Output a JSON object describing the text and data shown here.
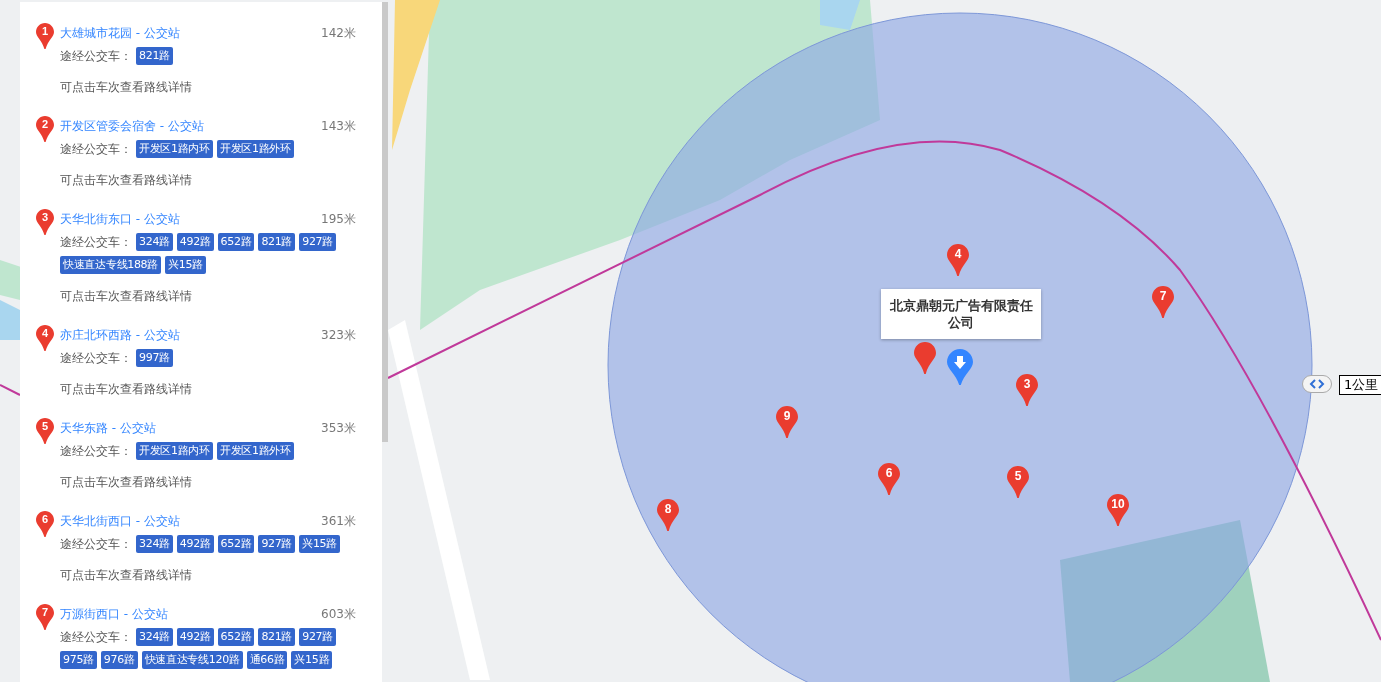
{
  "stations": [
    {
      "number": "1",
      "name": "大雄城市花园 - 公交站",
      "distance": "142米",
      "routes_label": "途经公交车：",
      "routes": [
        "821路"
      ],
      "hint": "可点击车次查看路线详情"
    },
    {
      "number": "2",
      "name": "开发区管委会宿舍 - 公交站",
      "distance": "143米",
      "routes_label": "途经公交车：",
      "routes": [
        "开发区1路内环",
        "开发区1路外环"
      ],
      "hint": "可点击车次查看路线详情"
    },
    {
      "number": "3",
      "name": "天华北街东口 - 公交站",
      "distance": "195米",
      "routes_label": "途经公交车：",
      "routes": [
        "324路",
        "492路",
        "652路",
        "821路",
        "927路",
        "快速直达专线188路",
        "兴15路"
      ],
      "hint": "可点击车次查看路线详情"
    },
    {
      "number": "4",
      "name": "亦庄北环西路 - 公交站",
      "distance": "323米",
      "routes_label": "途经公交车：",
      "routes": [
        "997路"
      ],
      "hint": "可点击车次查看路线详情"
    },
    {
      "number": "5",
      "name": "天华东路 - 公交站",
      "distance": "353米",
      "routes_label": "途经公交车：",
      "routes": [
        "开发区1路内环",
        "开发区1路外环"
      ],
      "hint": "可点击车次查看路线详情"
    },
    {
      "number": "6",
      "name": "天华北街西口 - 公交站",
      "distance": "361米",
      "routes_label": "途经公交车：",
      "routes": [
        "324路",
        "492路",
        "652路",
        "927路",
        "兴15路"
      ],
      "hint": "可点击车次查看路线详情"
    },
    {
      "number": "7",
      "name": "万源街西口 - 公交站",
      "distance": "603米",
      "routes_label": "途经公交车：",
      "routes": [
        "324路",
        "492路",
        "652路",
        "821路",
        "927路",
        "975路",
        "976路",
        "快速直达专线120路",
        "通66路",
        "兴15路"
      ]
    }
  ],
  "map": {
    "markers": [
      "3",
      "4",
      "5",
      "6",
      "7",
      "8",
      "9",
      "10"
    ],
    "callout": "北京鼎朝元广告有限责任公司",
    "scale": "1公里"
  }
}
